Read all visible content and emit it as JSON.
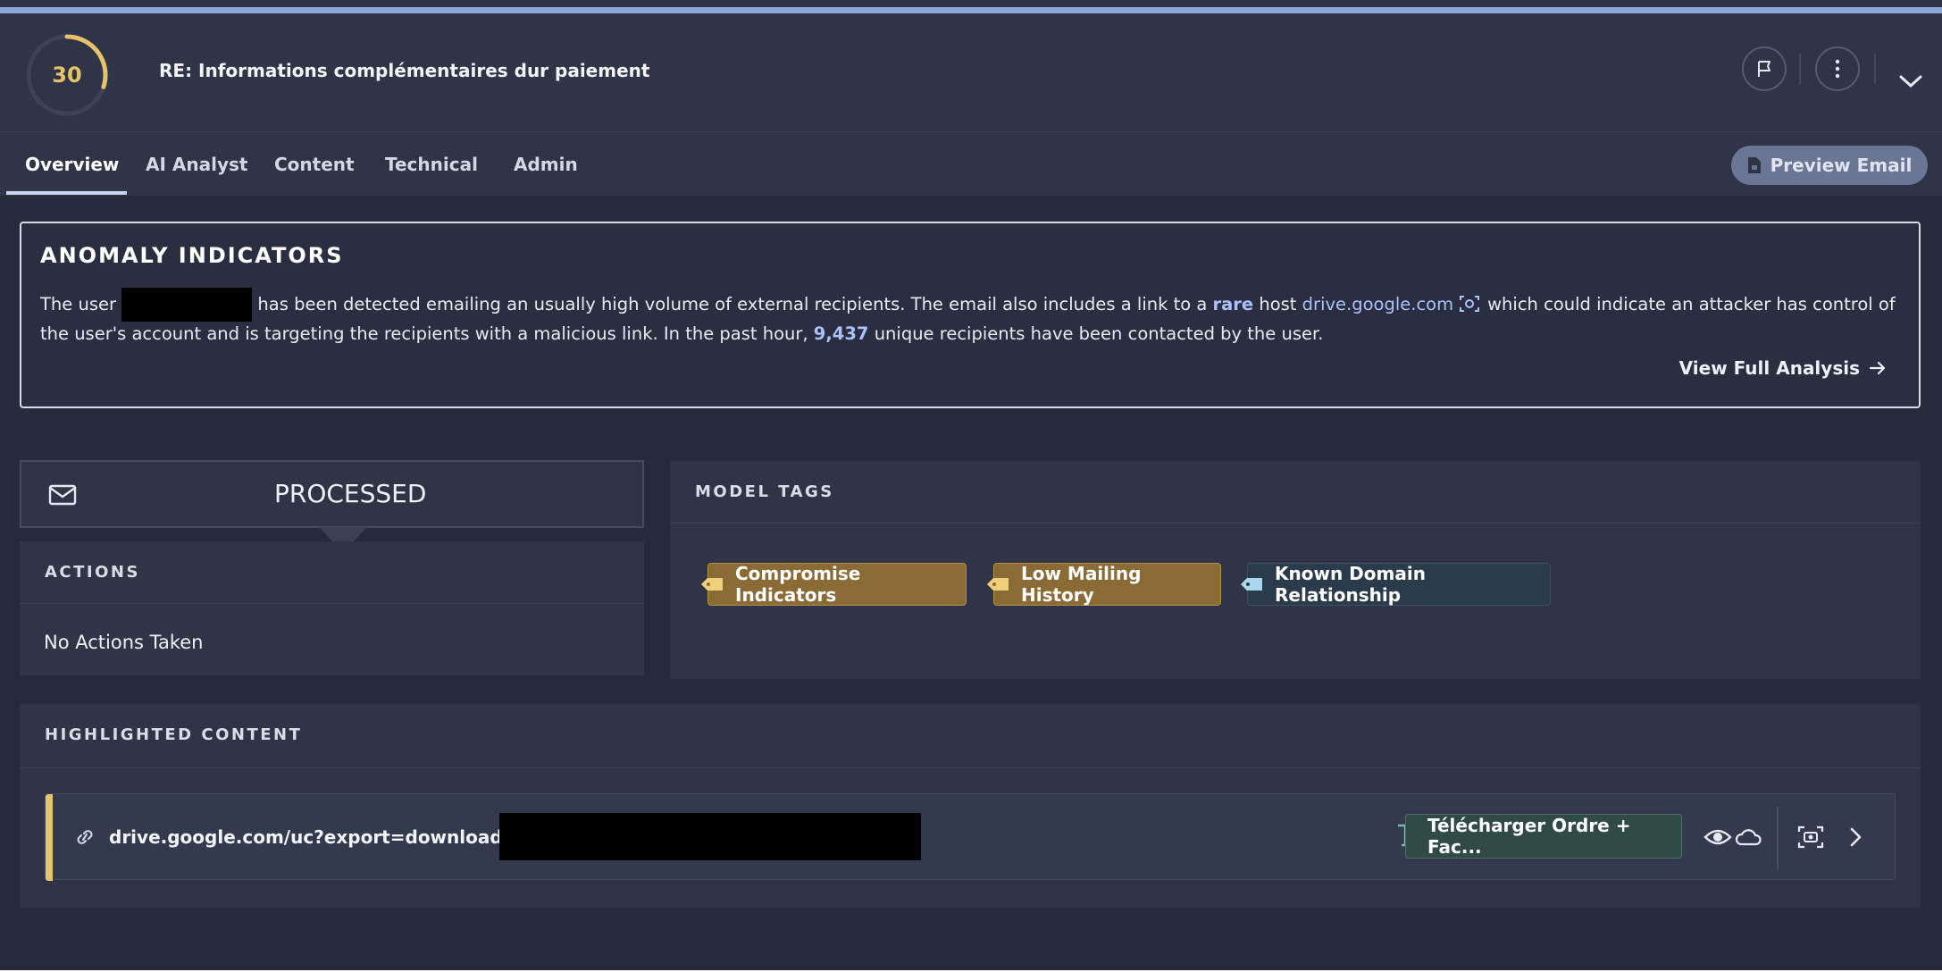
{
  "header": {
    "score": "30",
    "score_fraction": 0.3,
    "subject": "RE: Informations complémentaires dur paiement",
    "icons": [
      "flag-icon",
      "more-vertical-icon",
      "chevron-down-icon"
    ]
  },
  "tabs": [
    {
      "label": "Overview",
      "active": true
    },
    {
      "label": "AI Analyst",
      "active": false
    },
    {
      "label": "Content",
      "active": false
    },
    {
      "label": "Technical",
      "active": false
    },
    {
      "label": "Admin",
      "active": false
    }
  ],
  "preview_button": {
    "label": "Preview Email",
    "icon": "document-lock-icon"
  },
  "anomaly": {
    "title": "ANOMALY INDICATORS",
    "text_1": "The user",
    "text_2": "has been detected emailing an usually high volume of external recipients. The email also includes a link to a",
    "rare": "rare",
    "text_3": "host",
    "host": "drive.google.com",
    "text_4": "which could indicate an attacker has control of the user's account and is targeting the recipients with a malicious link. In the past hour,",
    "count": "9,437",
    "text_5": "unique recipients have been contacted by the user.",
    "view_full": "View Full Analysis"
  },
  "processed": {
    "label": "PROCESSED"
  },
  "actions": {
    "title": "ACTIONS",
    "value": "No Actions Taken"
  },
  "model_tags": {
    "title": "MODEL TAGS",
    "tags": [
      {
        "label": "Compromise Indicators",
        "style": "gold"
      },
      {
        "label": "Low Mailing History",
        "style": "gold"
      },
      {
        "label": "Known Domain Relationship",
        "style": "teal"
      }
    ]
  },
  "highlighted": {
    "title": "HIGHLIGHTED CONTENT",
    "url": "drive.google.com/uc?export=download&id=",
    "attachment": "Télécharger Ordre + Fac..."
  },
  "colors": {
    "background": "#262a3b",
    "panel": "#2f3447",
    "accent_gold": "#e8c56c",
    "link_blue": "#a9c2f7",
    "top_accent": "#8aa7da"
  }
}
